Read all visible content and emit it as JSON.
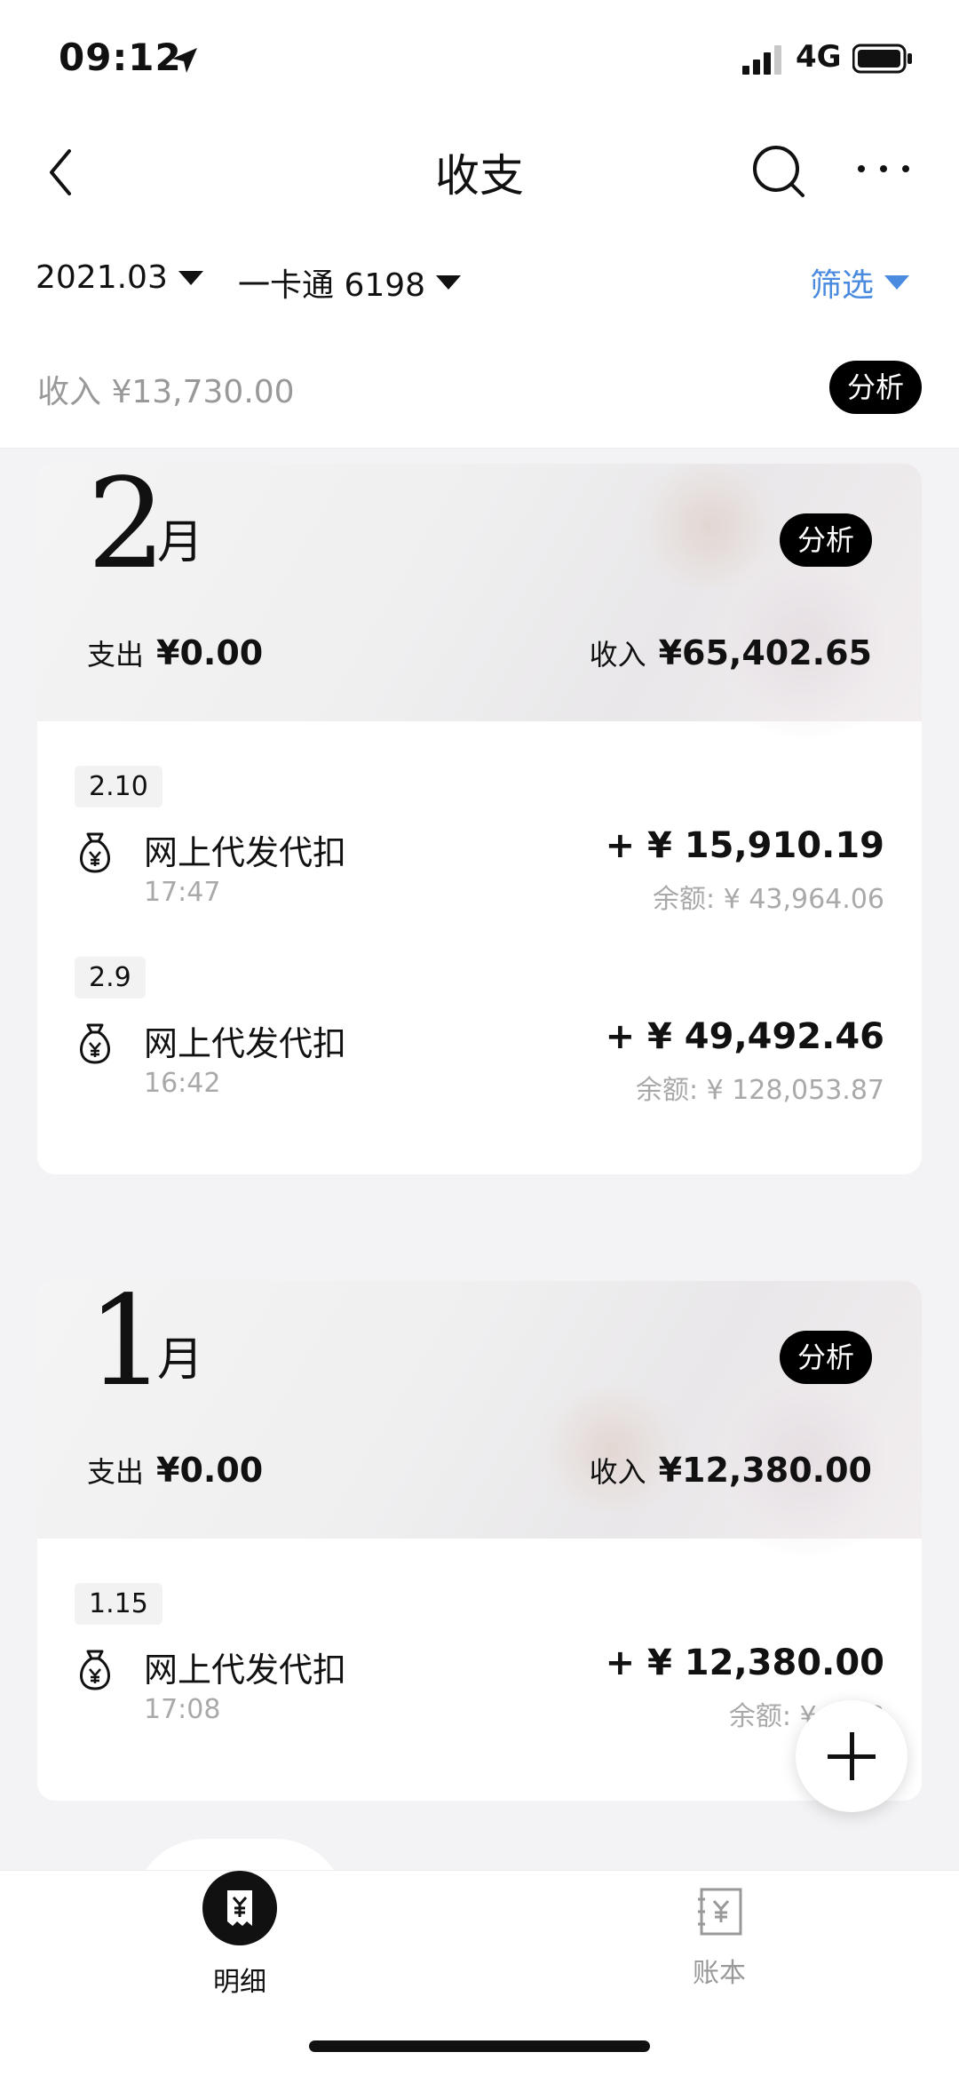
{
  "status_bar": {
    "time": "09:12",
    "network": "4G"
  },
  "nav": {
    "title": "收支"
  },
  "filters": {
    "date": "2021.03",
    "card": "一卡通 6198",
    "screen": "筛选"
  },
  "summary": {
    "income_text": "收入 ¥13,730.00",
    "analysis": "分析"
  },
  "months": [
    {
      "month": "2",
      "unit": "月",
      "analysis": "分析",
      "out_label": "支出",
      "out_amount": "¥0.00",
      "in_label": "收入",
      "in_amount": "¥65,402.65",
      "days": [
        {
          "date": "2.10",
          "txns": [
            {
              "name": "网上代发代扣",
              "time": "17:47",
              "amount": "+ ¥ 15,910.19",
              "balance": "余额: ¥ 43,964.06"
            }
          ]
        },
        {
          "date": "2.9",
          "txns": [
            {
              "name": "网上代发代扣",
              "time": "16:42",
              "amount": "+ ¥ 49,492.46",
              "balance": "余额: ¥ 128,053.87"
            }
          ]
        }
      ]
    },
    {
      "month": "1",
      "unit": "月",
      "analysis": "分析",
      "out_label": "支出",
      "out_amount": "¥0.00",
      "in_label": "收入",
      "in_amount": "¥12,380.00",
      "days": [
        {
          "date": "1.15",
          "txns": [
            {
              "name": "网上代发代扣",
              "time": "17:08",
              "amount": "+ ¥ 12,380.00",
              "balance": "余额: ¥ 22,8"
            }
          ]
        }
      ]
    }
  ],
  "tabs": [
    {
      "label": "明细",
      "icon": "receipt-yen-icon",
      "active": true
    },
    {
      "label": "账本",
      "icon": "ledger-yen-icon",
      "active": false
    }
  ],
  "icons": {
    "transaction": "money-bag-yen-icon"
  }
}
